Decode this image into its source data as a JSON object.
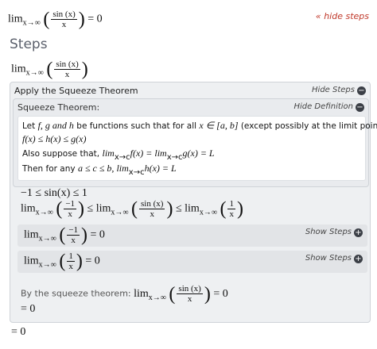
{
  "top": {
    "hide_steps": "« hide steps",
    "result": "= 0"
  },
  "steps": {
    "title": "Steps",
    "problem_fn_num": "sin (x)",
    "problem_fn_den": "x"
  },
  "lim": {
    "word": "lim",
    "sub_inf": "x→∞",
    "sub_c": "x→c"
  },
  "squeeze_section": {
    "header": "Apply the Squeeze Theorem",
    "hide_steps": "Hide Steps",
    "definition_header": "Squeeze Theorem:",
    "hide_definition": "Hide Definition",
    "def_line1_a": "Let ",
    "def_line1_b": " be functions such that for all ",
    "def_line1_c": " (except possibly at the limit point c),",
    "def_fgh": "f, g and h",
    "def_interval": "x ∈ [a, b]",
    "def_line2": "f(x) ≤ h(x) ≤ g(x)",
    "def_line3_a": "Also suppose that, ",
    "def_line3_b": "f(x) = ",
    "def_line3_c": "g(x) = L",
    "def_line4_a": "Then for any ",
    "def_line4_b": "a ≤ c ≤ b, ",
    "def_line4_c": "h(x) = L"
  },
  "inequalities": {
    "line1": "−1 ≤ sin(x) ≤ 1",
    "neg_one": "−1",
    "one": "1",
    "sin_num": "sin (x)",
    "x_den": "x",
    "le": "≤",
    "lim_mid": "lim"
  },
  "sub_steps": [
    {
      "num": "−1",
      "den": "x",
      "result": "= 0",
      "show_steps": "Show Steps"
    },
    {
      "num": "1",
      "den": "x",
      "result": "= 0",
      "show_steps": "Show Steps"
    }
  ],
  "conclusion": {
    "label": "By the squeeze theorem: ",
    "result": "= 0",
    "eq_zero": "= 0",
    "final": "= 0"
  },
  "icons": {
    "minus": "−",
    "plus": "+"
  }
}
